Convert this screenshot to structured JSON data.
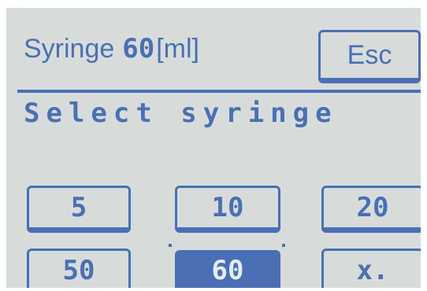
{
  "header": {
    "label": "Syringe",
    "value": "60",
    "unit": "[ml]",
    "esc_label": "Esc"
  },
  "prompt": "Select syringe",
  "options": [
    "5",
    "10",
    "20",
    "50",
    "60",
    "x."
  ],
  "selected": "60",
  "colors": {
    "screen_bg": "#d7dcdb",
    "pixel": "#4a6fb5",
    "selected_text": "#e6ebf2"
  }
}
